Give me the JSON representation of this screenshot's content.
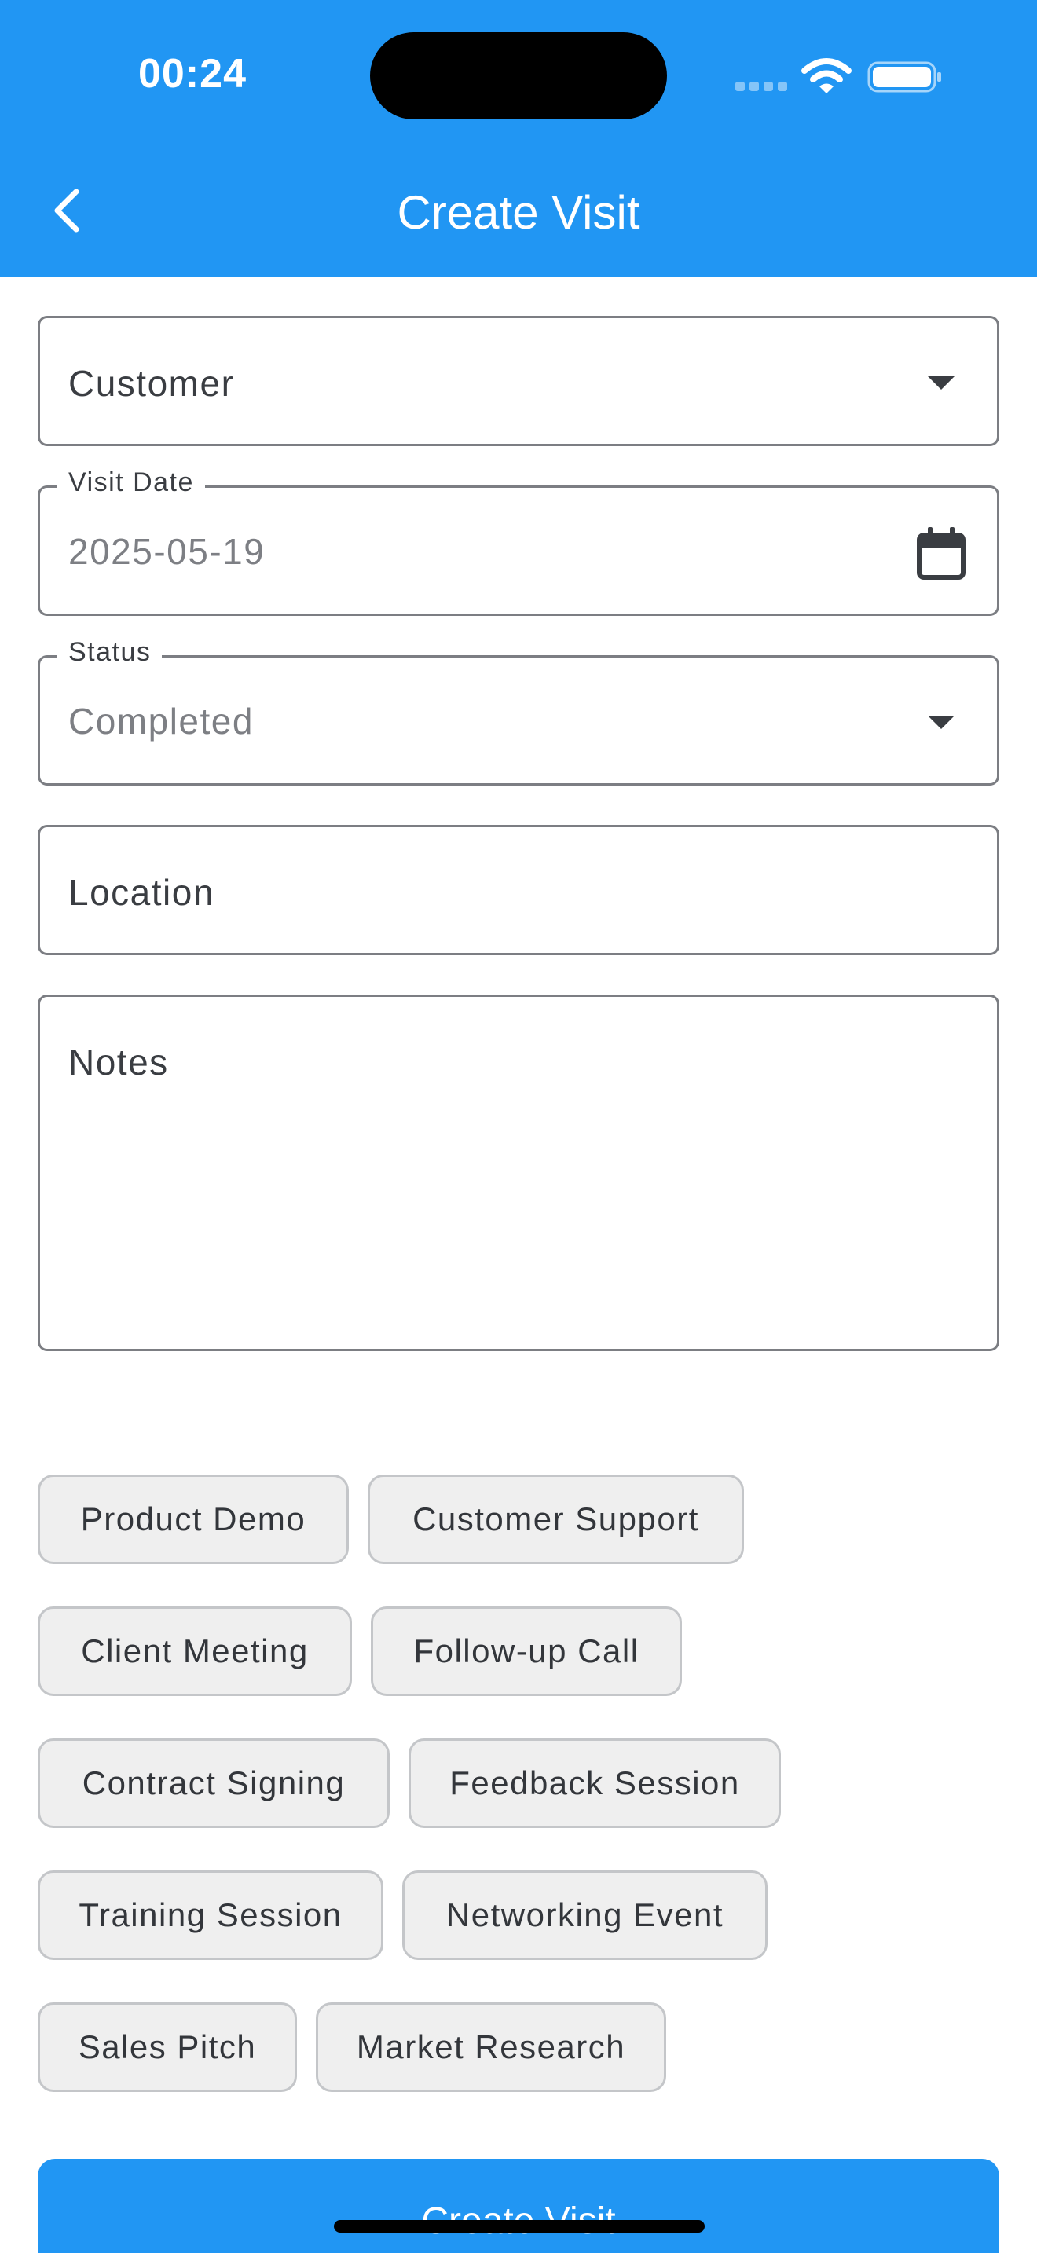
{
  "status_bar": {
    "time": "00:24"
  },
  "appbar": {
    "title": "Create Visit",
    "back_icon": "chevron-left-icon"
  },
  "form": {
    "customer": {
      "label": "Customer"
    },
    "visit_date": {
      "label": "Visit Date",
      "value": "2025-05-19",
      "icon": "calendar-icon"
    },
    "status": {
      "label": "Status",
      "value": "Completed"
    },
    "location": {
      "label": "Location"
    },
    "notes": {
      "label": "Notes"
    }
  },
  "chips": [
    "Product Demo",
    "Customer Support",
    "Client Meeting",
    "Follow-up Call",
    "Contract Signing",
    "Feedback Session",
    "Training Session",
    "Networking Event",
    "Sales Pitch",
    "Market Research"
  ],
  "submit": {
    "label": "Create Visit"
  },
  "colors": {
    "primary": "#2196f3",
    "chip_bg": "#efefef",
    "chip_border": "#c4c6c9",
    "field_border": "#7c7e83"
  }
}
